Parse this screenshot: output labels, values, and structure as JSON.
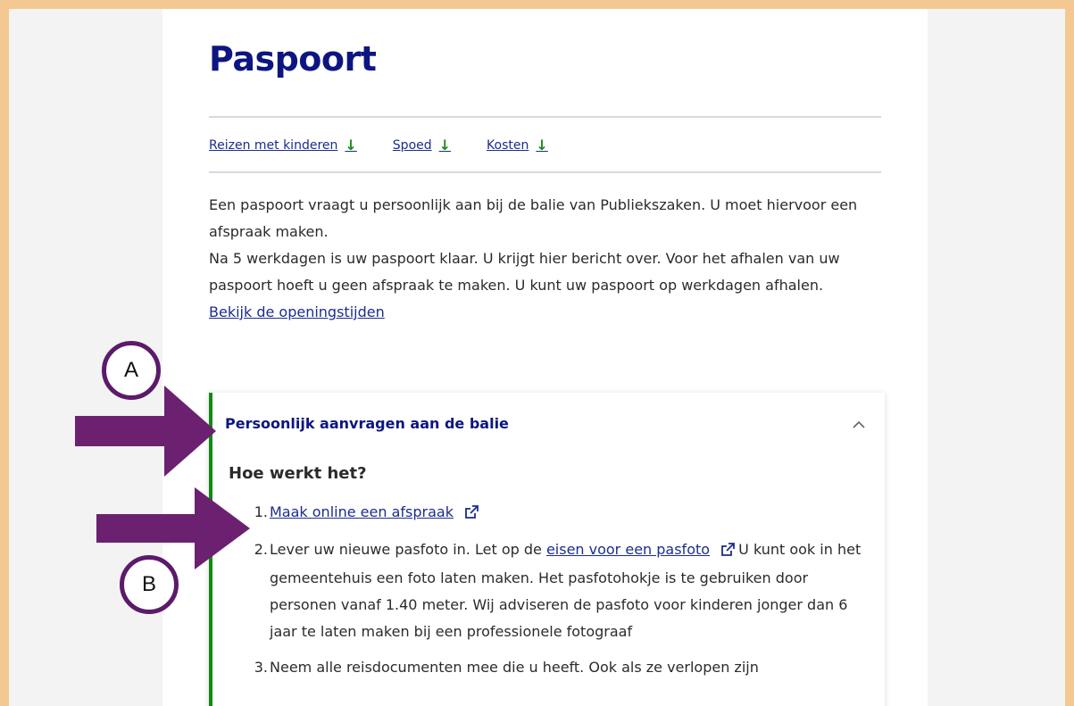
{
  "page": {
    "title": "Paspoort"
  },
  "anchors": [
    {
      "label": "Reizen met kinderen",
      "icon": "arrow-down-icon"
    },
    {
      "label": "Spoed",
      "icon": "arrow-down-icon"
    },
    {
      "label": "Kosten",
      "icon": "arrow-down-icon"
    }
  ],
  "intro": {
    "line1": "Een paspoort vraagt u persoonlijk aan bij de balie van Publiekszaken. U moet hiervoor een afspraak maken.",
    "line2": "Na 5 werkdagen is uw paspoort klaar. U krijgt hier bericht over. Voor het afhalen van uw paspoort hoeft u geen afspraak te maken. U kunt uw paspoort op werkdagen afhalen.",
    "link": "Bekijk de openingstijden"
  },
  "accordion": {
    "title": "Persoonlijk aanvragen aan de balie",
    "expanded_icon": "chevron-up-icon",
    "subtitle": "Hoe werkt het?",
    "steps": [
      {
        "num": "1.",
        "link": "Maak online een afspraak"
      },
      {
        "num": "2.",
        "text_before": "Lever uw nieuwe pasfoto in. Let op de",
        "link": "eisen voor een pasfoto",
        "text_after": "U kunt ook in het gemeentehuis een foto laten maken. Het pasfotohokje is te gebruiken door personen vanaf 1.40 meter. Wij adviseren de pasfoto voor kinderen jonger dan 6 jaar te laten maken bij een professionele fotograaf"
      },
      {
        "num": "3.",
        "text": "Neem alle reisdocumenten mee die u heeft. Ook als ze verlopen zijn"
      }
    ]
  },
  "annotations": {
    "a_label": "A",
    "b_label": "B",
    "color": "#5c1a6b"
  },
  "colors": {
    "frame": "#f5c891",
    "title": "#0d1680",
    "link": "#1a2d8f",
    "accent_green": "#138a13"
  }
}
